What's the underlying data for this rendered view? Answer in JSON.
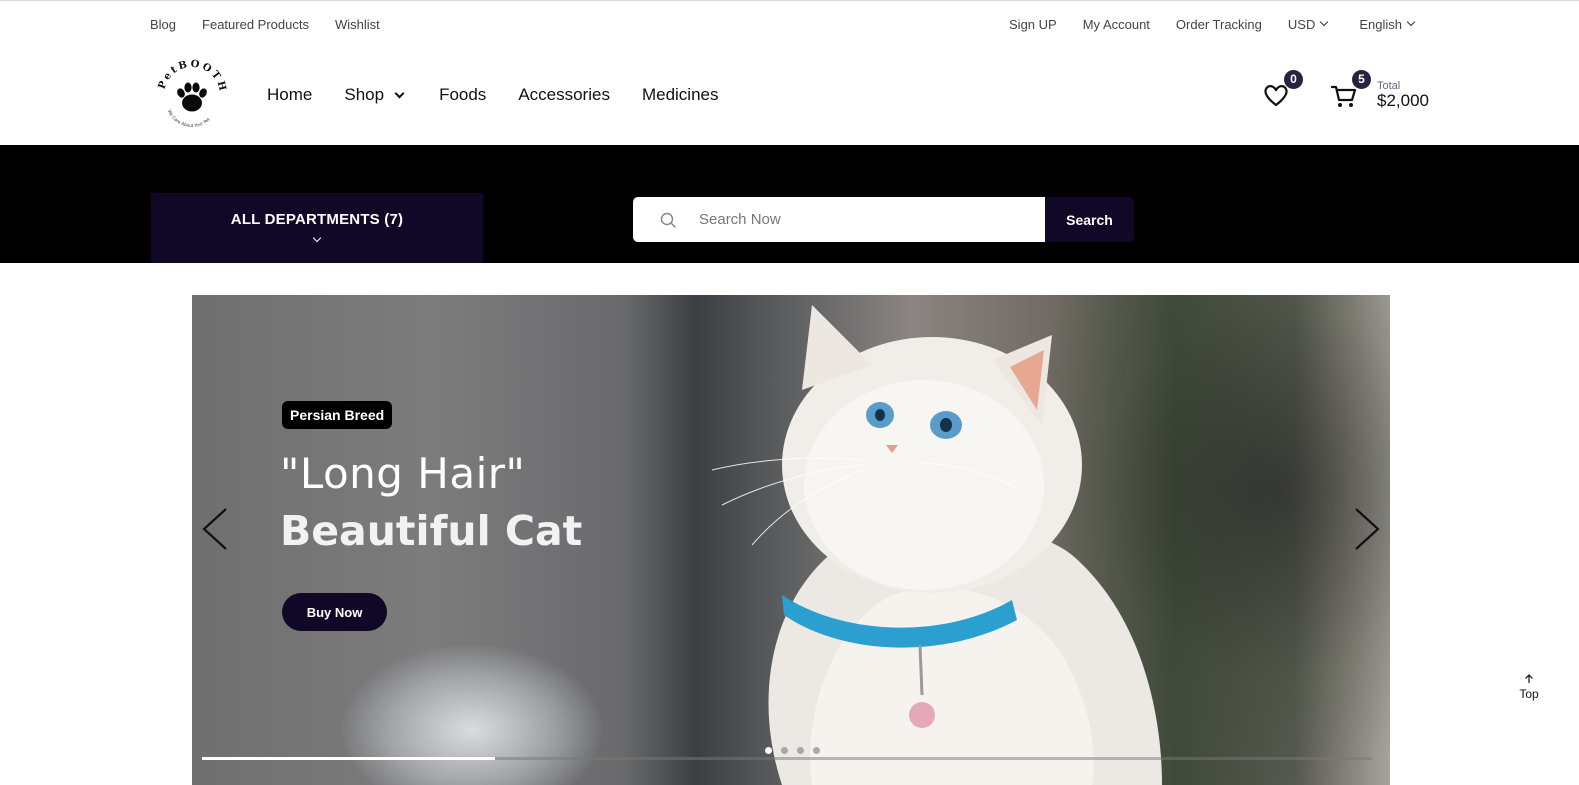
{
  "topbar": {
    "left_links": [
      "Blog",
      "Featured Products",
      "Wishlist"
    ],
    "right_links": [
      "Sign UP",
      "My Account",
      "Order Tracking"
    ],
    "currency": "USD",
    "language": "English"
  },
  "header": {
    "logo_text": "PetBOOTH",
    "logo_tagline": "We Care About Your Pet",
    "nav": {
      "home": "Home",
      "shop": "Shop",
      "foods": "Foods",
      "accessories": "Accessories",
      "medicines": "Medicines"
    },
    "wishlist_count": "0",
    "cart_count": "5",
    "total_label": "Total",
    "total_amount": "$2,000"
  },
  "search_band": {
    "departments_label": "ALL DEPARTMENTS (7)",
    "search_placeholder": "Search Now",
    "search_button": "Search"
  },
  "hero": {
    "tag": "Persian Breed",
    "line1": "\"Long Hair\"",
    "line2": "Beautiful Cat",
    "button": "Buy Now",
    "slide_count": 4,
    "active_slide": 1,
    "progress_fraction": 0.25
  },
  "back_to_top": "Top",
  "colors": {
    "accent_dark": "#110726",
    "badge": "#2a2140",
    "band": "#000000"
  },
  "icons": [
    "search-icon",
    "heart-icon",
    "cart-icon",
    "chevron-down-icon",
    "arrow-left-icon",
    "arrow-right-icon",
    "arrow-up-icon",
    "paw-icon"
  ]
}
